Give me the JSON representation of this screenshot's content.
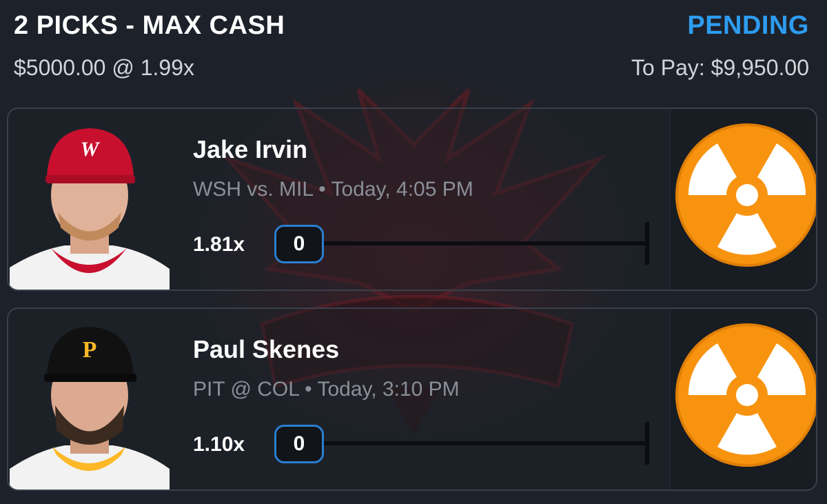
{
  "slip": {
    "title": "2 PICKS - MAX CASH",
    "status": "PENDING",
    "stake_line": "$5000.00 @ 1.99x",
    "payout_line": "To Pay: $9,950.00"
  },
  "colors": {
    "background": "#1d2129",
    "status_accent": "#2d9cf0",
    "stat_box_border": "#2b7fd1",
    "pending_badge": "#f7930e"
  },
  "picks": [
    {
      "player": "Jake Irvin",
      "game": "WSH vs. MIL • Today, 4:05 PM",
      "multiplier": "1.81x",
      "current_stat": "0",
      "progress": 0,
      "status_icon": "radioactive-icon"
    },
    {
      "player": "Paul Skenes",
      "game": "PIT @ COL • Today, 3:10 PM",
      "multiplier": "1.10x",
      "current_stat": "0",
      "progress": 0,
      "status_icon": "radioactive-icon"
    }
  ]
}
